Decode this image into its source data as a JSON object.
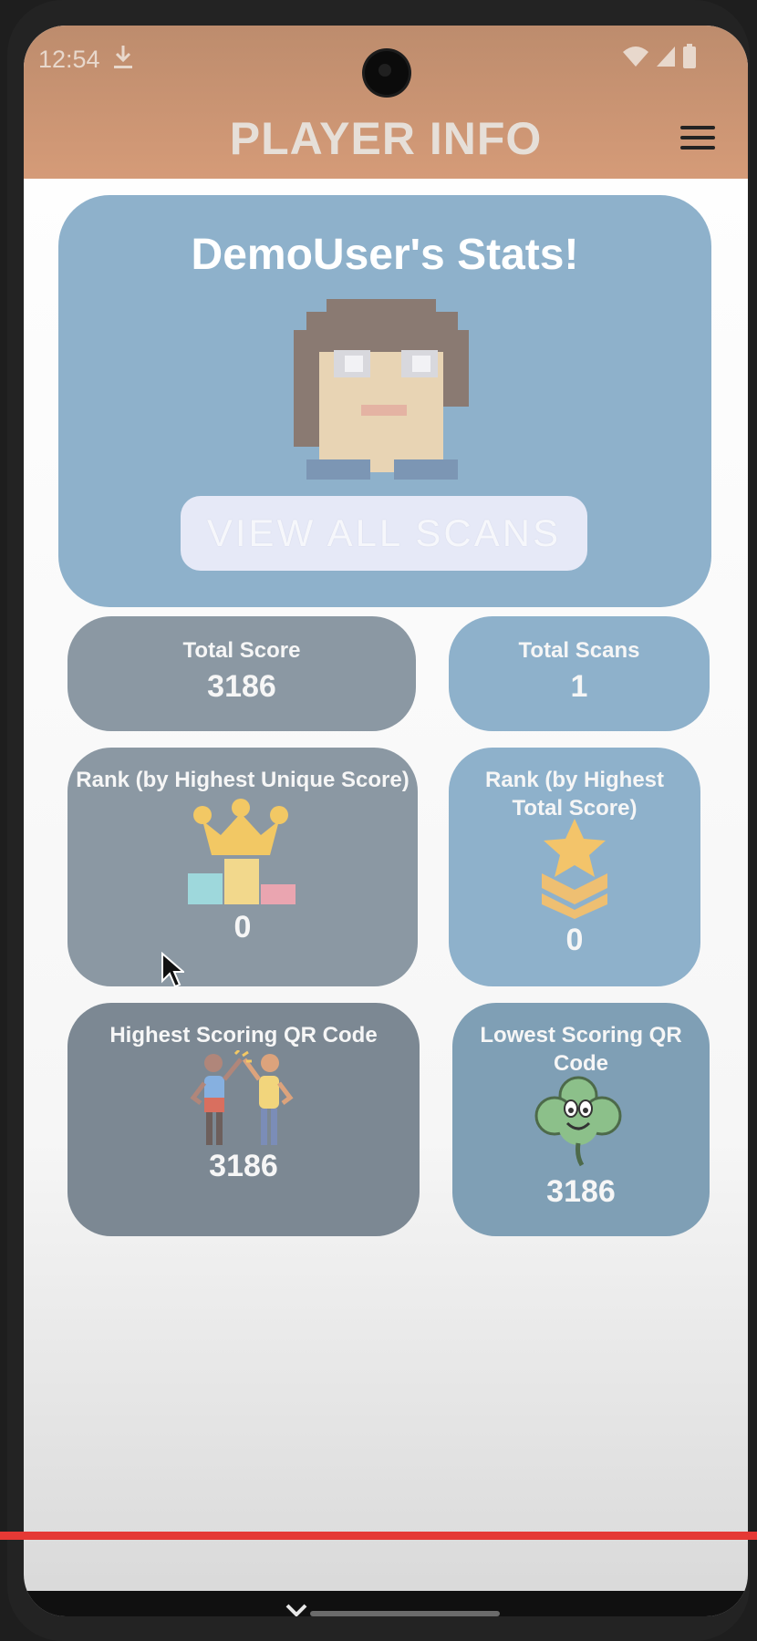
{
  "status_bar": {
    "time": "12:54"
  },
  "header": {
    "title": "PLAYER INFO"
  },
  "hero": {
    "title": "DemoUser's Stats!",
    "view_scans_label": "VIEW ALL SCANS"
  },
  "stats": {
    "total_score": {
      "label": "Total Score",
      "value": "3186"
    },
    "total_scans": {
      "label": "Total Scans",
      "value": "1"
    },
    "rank_unique": {
      "label": "Rank (by Highest Unique Score)",
      "value": "0",
      "icon": "crown-podium-icon"
    },
    "rank_total": {
      "label_line1": "Rank (by Highest",
      "label_line2": "Total Score)",
      "value": "0",
      "icon": "star-chevron-icon"
    },
    "highest_qr": {
      "label": "Highest Scoring QR Code",
      "value": "3186",
      "icon": "high-five-icon"
    },
    "lowest_qr": {
      "label_line1": "Lowest Scoring QR",
      "label_line2": "Code",
      "value": "3186",
      "icon": "clover-icon"
    }
  },
  "colors": {
    "header_bg": "#d59b78",
    "hero_bg": "#8eb1cb",
    "dark_card_bg": "#8b98a3",
    "button_bg": "#e6e9f7",
    "progress": "#e53935"
  }
}
